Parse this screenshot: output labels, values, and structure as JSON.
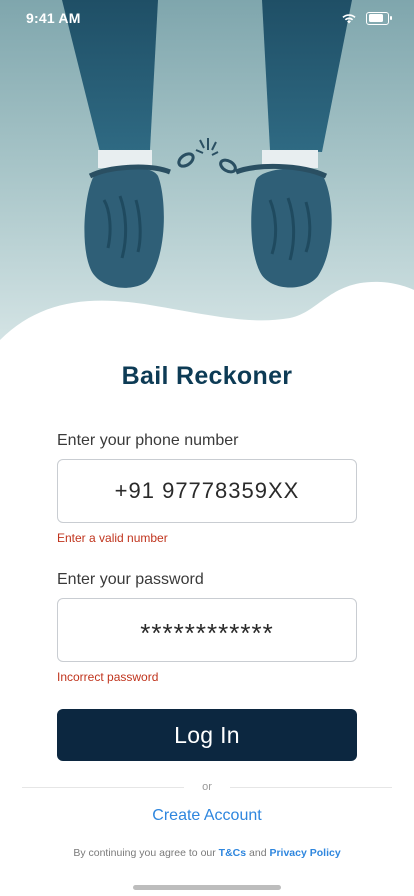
{
  "status_bar": {
    "time": "9:41 AM"
  },
  "app": {
    "title": "Bail Reckoner"
  },
  "phone": {
    "label": "Enter your phone number",
    "value": "+91  97778359XX",
    "error": "Enter a valid number"
  },
  "password": {
    "label": "Enter your password",
    "value": "************",
    "error": "Incorrect password"
  },
  "login_button": {
    "label": "Log In"
  },
  "divider": {
    "text": "or"
  },
  "create_account": {
    "label": "Create Account"
  },
  "terms": {
    "prefix": "By continuing you agree to our ",
    "tnc": "T&Cs",
    "and": " and ",
    "privacy": "Privacy Policy"
  },
  "colors": {
    "brand_dark": "#0c2740",
    "title": "#0d3b55",
    "link": "#2e86de",
    "error": "#c0341d"
  },
  "icons": [
    "wifi-icon",
    "battery-icon"
  ]
}
